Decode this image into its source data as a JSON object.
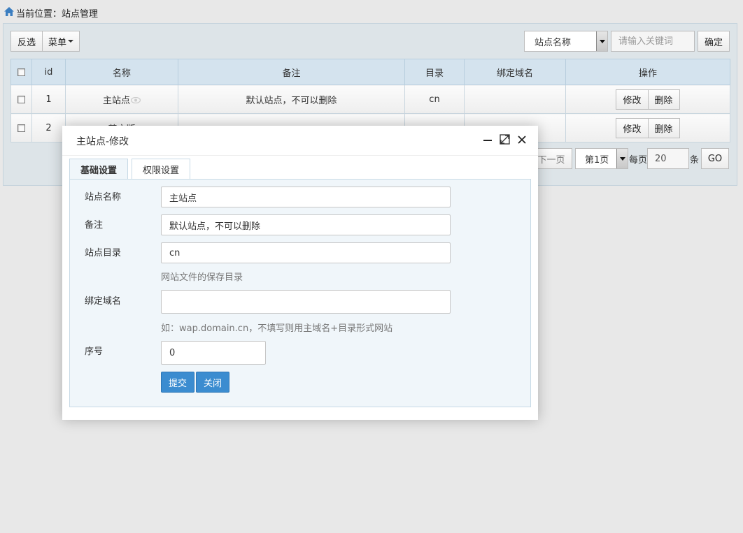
{
  "breadcrumb": {
    "prefix": "当前位置：",
    "current": "站点管理"
  },
  "toolbar": {
    "invert_label": "反选",
    "menu_label": "菜单"
  },
  "search": {
    "field_selected": "站点名称",
    "placeholder": "请输入关键词",
    "confirm_label": "确定"
  },
  "table": {
    "headers": [
      "",
      "id",
      "名称",
      "备注",
      "目录",
      "绑定域名",
      "操作"
    ],
    "rows": [
      {
        "id": "1",
        "name": "主站点",
        "note": "默认站点，不可以删除",
        "dir": "cn",
        "domain": "",
        "edit": "修改",
        "delete": "删除"
      },
      {
        "id": "2",
        "name": "英文版",
        "note": "",
        "dir": "",
        "domain": "",
        "edit": "修改",
        "delete": "删除"
      }
    ]
  },
  "pager": {
    "next_label": "下一页",
    "page_selected": "第1页",
    "per_page_prefix": "每页",
    "per_page_value": "20",
    "per_page_suffix": "条",
    "go_label": "GO"
  },
  "modal": {
    "title": "主站点-修改",
    "tabs": [
      {
        "label": "基础设置",
        "active": true
      },
      {
        "label": "权限设置",
        "active": false
      }
    ],
    "form": {
      "site_name_label": "站点名称",
      "site_name_value": "主站点",
      "note_label": "备注",
      "note_value": "默认站点，不可以删除",
      "dir_label": "站点目录",
      "dir_value": "cn",
      "dir_hint": "网站文件的保存目录",
      "domain_label": "绑定域名",
      "domain_value": "",
      "domain_hint": "如：wap.domain.cn，不填写则用主域名+目录形式网站",
      "order_label": "序号",
      "order_value": "0",
      "submit_label": "提交",
      "close_label": "关闭"
    }
  },
  "colors": {
    "primary_button": "#3b8cd0",
    "table_header": "#d4e3ee",
    "page_bg": "#e8e8e8"
  }
}
